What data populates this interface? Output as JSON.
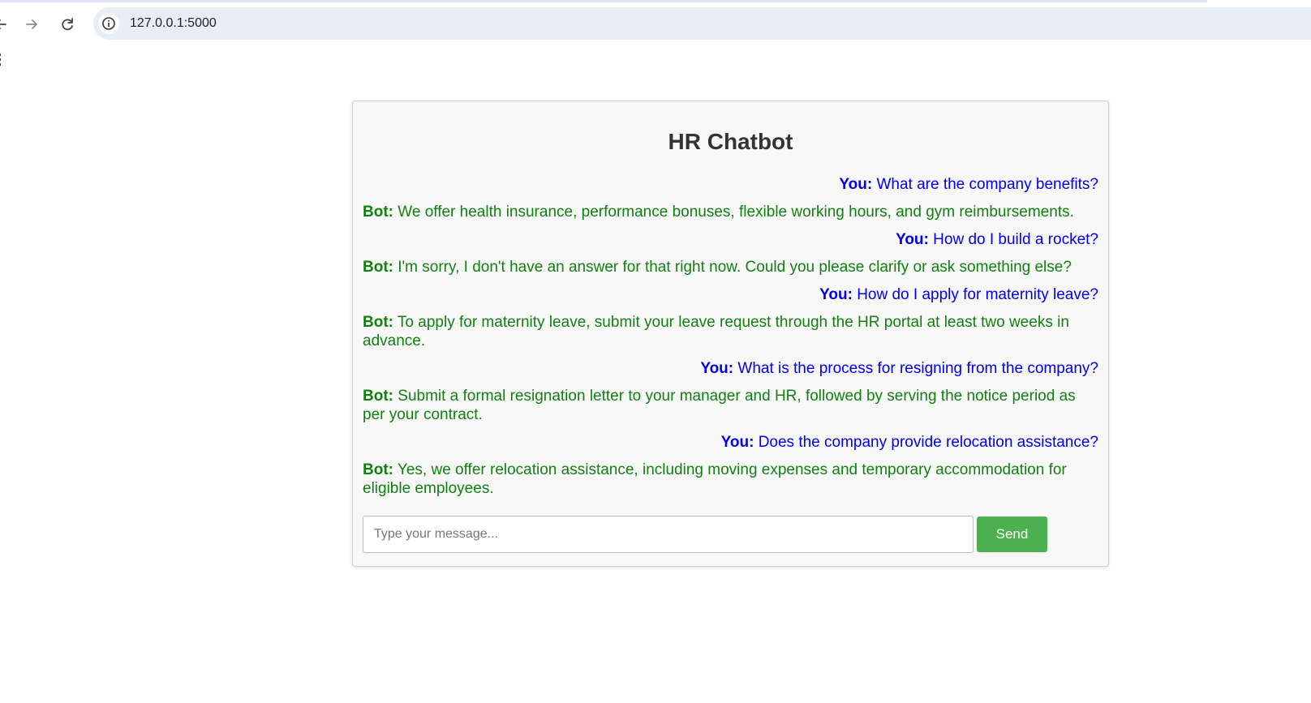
{
  "browser": {
    "url": "127.0.0.1:5000",
    "icons": {
      "back": "arrow-left-icon",
      "forward": "arrow-right-icon",
      "reload": "reload-icon",
      "site_info": "info-icon"
    }
  },
  "chat": {
    "title": "HR Chatbot",
    "user_label": "You:",
    "bot_label": "Bot:",
    "messages": [
      {
        "sender": "user",
        "text": "What are the company benefits?"
      },
      {
        "sender": "bot",
        "text": "We offer health insurance, performance bonuses, flexible working hours, and gym reimbursements."
      },
      {
        "sender": "user",
        "text": "How do I build a rocket?"
      },
      {
        "sender": "bot",
        "text": "I'm sorry, I don't have an answer for that right now. Could you please clarify or ask something else?"
      },
      {
        "sender": "user",
        "text": "How do I apply for maternity leave?"
      },
      {
        "sender": "bot",
        "text": "To apply for maternity leave, submit your leave request through the HR portal at least two weeks in advance."
      },
      {
        "sender": "user",
        "text": "What is the process for resigning from the company?"
      },
      {
        "sender": "bot",
        "text": "Submit a formal resignation letter to your manager and HR, followed by serving the notice period as per your contract."
      },
      {
        "sender": "user",
        "text": "Does the company provide relocation assistance?"
      },
      {
        "sender": "bot",
        "text": "Yes, we offer relocation assistance, including moving expenses and temporary accommodation for eligible employees."
      }
    ],
    "input": {
      "value": "",
      "placeholder": "Type your message..."
    },
    "send_label": "Send"
  },
  "colors": {
    "user_text": "#0000ee",
    "bot_text": "#118011",
    "send_button": "#4caf50",
    "panel_bg": "#f8f8f8"
  }
}
